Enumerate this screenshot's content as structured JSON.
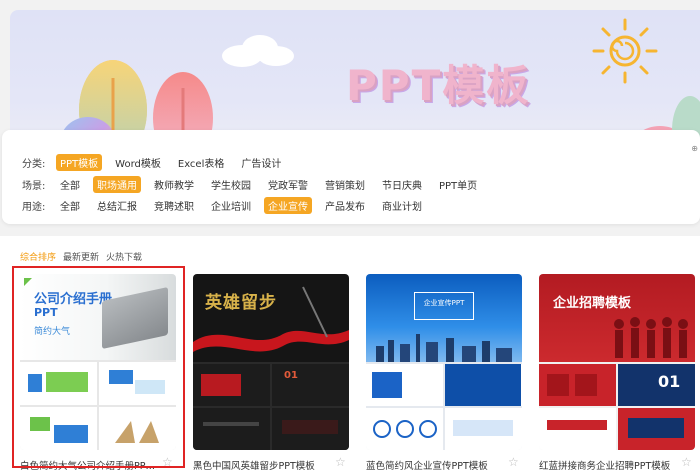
{
  "banner": {
    "title": "PPT模板"
  },
  "filters": {
    "category": {
      "label": "分类:",
      "items": [
        "PPT模板",
        "Word模板",
        "Excel表格",
        "广告设计"
      ],
      "active": 0
    },
    "scene": {
      "label": "场景:",
      "items": [
        "全部",
        "职场通用",
        "教师教学",
        "学生校园",
        "党政军警",
        "营销策划",
        "节日庆典",
        "PPT单页"
      ],
      "active": 1
    },
    "usage": {
      "label": "用途:",
      "items": [
        "全部",
        "总结汇报",
        "竞聘述职",
        "企业培训",
        "企业宣传",
        "产品发布",
        "商业计划"
      ],
      "active": 4
    }
  },
  "sort": {
    "items": [
      "综合排序",
      "最新更新",
      "火热下载"
    ],
    "active": 0
  },
  "cards": [
    {
      "title": "白色简约大气公司介绍手册PPT模板",
      "thumb_title": "公司介绍手册",
      "thumb_ppt": "PPT",
      "thumb_sub": "简约大气"
    },
    {
      "title": "黑色中国风英雄留步PPT模板",
      "thumb_title": "英雄留步"
    },
    {
      "title": "蓝色简约风企业宣传PPT模板",
      "thumb_title": "企业宣传PPT"
    },
    {
      "title": "红蓝拼接商务企业招聘PPT模板",
      "thumb_title": "企业招聘模板"
    }
  ],
  "colors": {
    "accent": "#f5a623",
    "selection": "#e02424"
  }
}
